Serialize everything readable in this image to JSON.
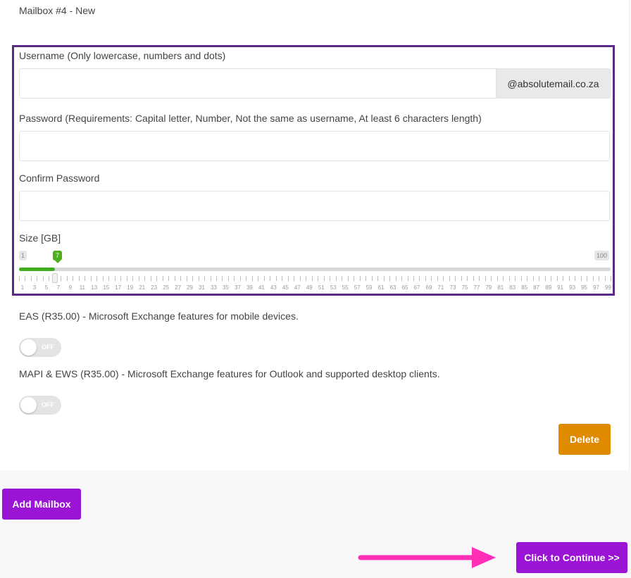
{
  "mailbox": {
    "title": "Mailbox #4 - New"
  },
  "username": {
    "label": "Username (Only lowercase, numbers and dots)",
    "value": "",
    "domain": "@absolutemail.co.za"
  },
  "password": {
    "label": "Password (Requirements: Capital letter, Number, Not the same as username, At least 6 characters length)",
    "value": ""
  },
  "confirm_password": {
    "label": "Confirm Password",
    "value": ""
  },
  "size": {
    "label": "Size [GB]",
    "min": "1",
    "max": "100",
    "value": "7",
    "value_number": 7,
    "scale": [
      "1",
      "3",
      "5",
      "7",
      "9",
      "11",
      "13",
      "15",
      "17",
      "19",
      "21",
      "23",
      "25",
      "27",
      "29",
      "31",
      "33",
      "35",
      "37",
      "39",
      "41",
      "43",
      "45",
      "47",
      "49",
      "51",
      "53",
      "55",
      "57",
      "59",
      "61",
      "63",
      "65",
      "67",
      "69",
      "71",
      "73",
      "75",
      "77",
      "79",
      "81",
      "83",
      "85",
      "87",
      "89",
      "91",
      "93",
      "95",
      "97",
      "99"
    ]
  },
  "options": {
    "eas": {
      "label": "EAS (R35.00) - Microsoft Exchange features for mobile devices.",
      "state": "OFF"
    },
    "mapi": {
      "label": "MAPI & EWS (R35.00) - Microsoft Exchange features for Outlook and supported desktop clients.",
      "state": "OFF"
    }
  },
  "buttons": {
    "delete": "Delete",
    "add_mailbox": "Add Mailbox",
    "continue": "Click to Continue >>"
  },
  "colors": {
    "frame": "#5b2a86",
    "slider_fill": "#3fae1c",
    "delete": "#e08a00",
    "primary": "#9b14d6",
    "arrow": "#ff2fb8"
  }
}
